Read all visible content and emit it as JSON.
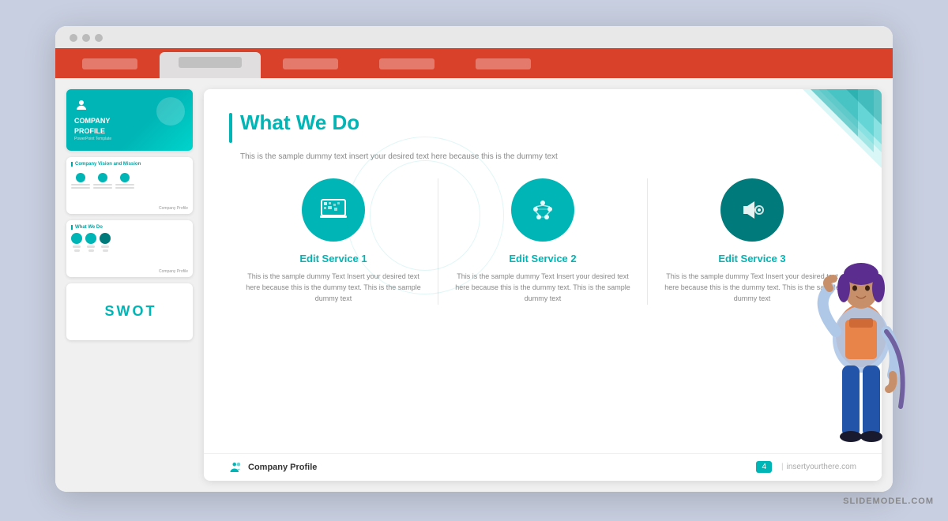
{
  "browser": {
    "dots": [
      "gray",
      "gray",
      "gray"
    ],
    "tabs": [
      {
        "label": "",
        "active": false
      },
      {
        "label": "",
        "active": true
      },
      {
        "label": "",
        "active": false
      },
      {
        "label": "",
        "active": false
      },
      {
        "label": "",
        "active": false
      },
      {
        "label": "",
        "active": false
      }
    ]
  },
  "sidebar": {
    "thumbnails": [
      {
        "id": "thumb-1",
        "type": "company-profile",
        "title": "COMPANY",
        "subtitle": "PROFILE",
        "sub2": "PowerPoint Template"
      },
      {
        "id": "thumb-2",
        "type": "vision-mission",
        "header": "Company Vision and Mission"
      },
      {
        "id": "thumb-3",
        "type": "what-we-do",
        "header": "What We Do"
      },
      {
        "id": "thumb-4",
        "type": "swot",
        "letters": [
          "S",
          "W",
          "O",
          "T"
        ]
      }
    ]
  },
  "slide": {
    "title": "What We Do",
    "subtitle": "This is the sample dummy text insert your desired text here because this is the dummy text",
    "services": [
      {
        "id": "service-1",
        "title": "Edit Service 1",
        "icon": "laptop",
        "text": "This is the sample dummy Text Insert your desired text here because this is the dummy text. This is the sample dummy text"
      },
      {
        "id": "service-2",
        "title": "Edit Service 2",
        "icon": "brain",
        "text": "This is the sample dummy Text Insert your desired text here because this is the dummy text. This is the sample dummy text"
      },
      {
        "id": "service-3",
        "title": "Edit Service 3",
        "icon": "megaphone",
        "text": "This is the sample dummy Text Insert your desired text here because this is the dummy text. This is the sample dummy text",
        "dark": true
      }
    ],
    "footer": {
      "logo_text": "Company Profile",
      "page_number": "4",
      "divider": "|",
      "url": "insertyourthere.com"
    }
  },
  "watermark": {
    "text": "SLIDEMODEL.COM"
  }
}
